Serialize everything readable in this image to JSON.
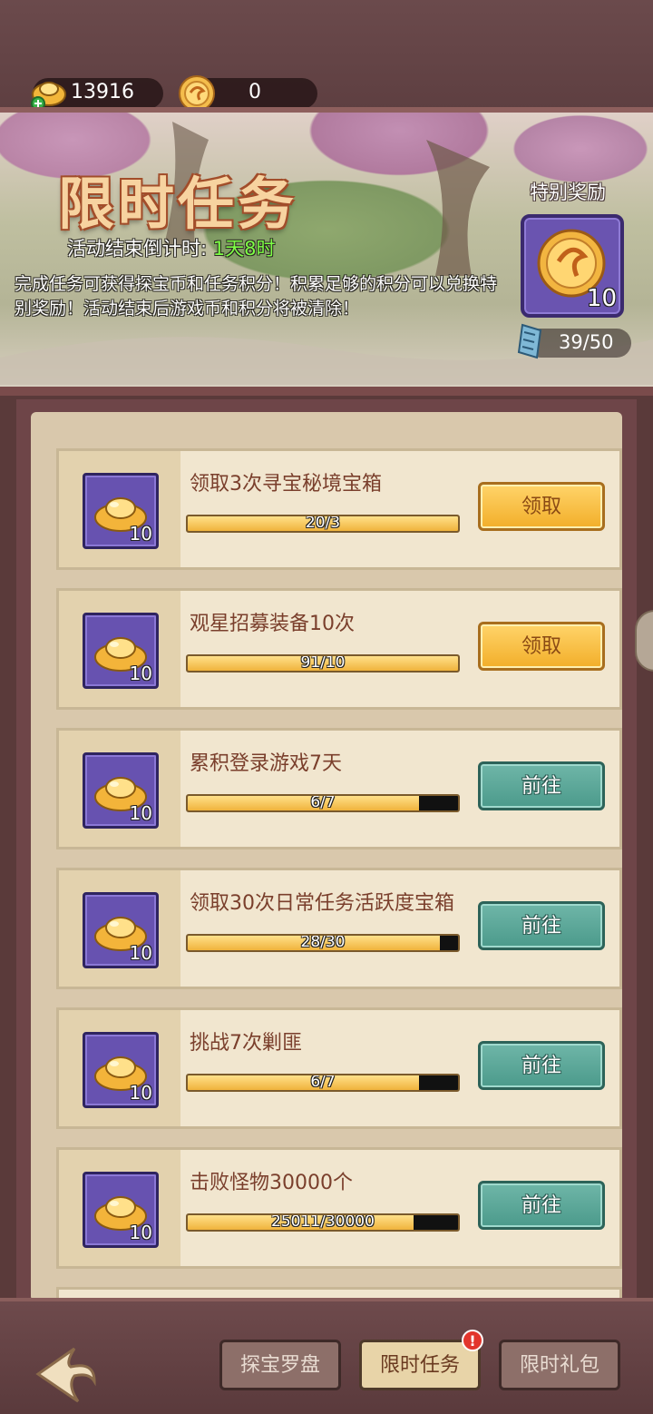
{
  "currencies": {
    "gold_value": "13916",
    "coin_value": "0"
  },
  "banner": {
    "title": "限时任务",
    "countdown_label": "活动结束倒计时: ",
    "countdown_value": "1天8时",
    "description": "完成任务可获得探宝币和任务积分！积累足够的积分可以兑换特别奖励！活动结束后游戏币和积分将被清除！",
    "special_reward_label": "特别奖励",
    "special_reward_count": "10",
    "points": "39/50"
  },
  "tasks": [
    {
      "title": "领取3次寻宝秘境宝箱",
      "progress_text": "20/3",
      "progress": 1.0,
      "reward": "10",
      "button": "领取",
      "button_type": "claim"
    },
    {
      "title": "观星招募装备10次",
      "progress_text": "91/10",
      "progress": 1.0,
      "reward": "10",
      "button": "领取",
      "button_type": "claim"
    },
    {
      "title": "累积登录游戏7天",
      "progress_text": "6/7",
      "progress": 0.857,
      "reward": "10",
      "button": "前往",
      "button_type": "go"
    },
    {
      "title": "领取30次日常任务活跃度宝箱",
      "progress_text": "28/30",
      "progress": 0.933,
      "reward": "10",
      "button": "前往",
      "button_type": "go"
    },
    {
      "title": "挑战7次剿匪",
      "progress_text": "6/7",
      "progress": 0.857,
      "reward": "10",
      "button": "前往",
      "button_type": "go"
    },
    {
      "title": "击败怪物30000个",
      "progress_text": "25011/30000",
      "progress": 0.834,
      "reward": "10",
      "button": "前往",
      "button_type": "go"
    }
  ],
  "bottom_tabs": [
    {
      "label": "探宝罗盘",
      "active": false
    },
    {
      "label": "限时任务",
      "active": true,
      "badge": "!"
    },
    {
      "label": "限时礼包",
      "active": false
    }
  ],
  "colors": {
    "claim_button": "#f2ae29",
    "go_button": "#4b9a8b",
    "countdown_highlight": "#7dff45",
    "reward_box": "#6752b0"
  }
}
